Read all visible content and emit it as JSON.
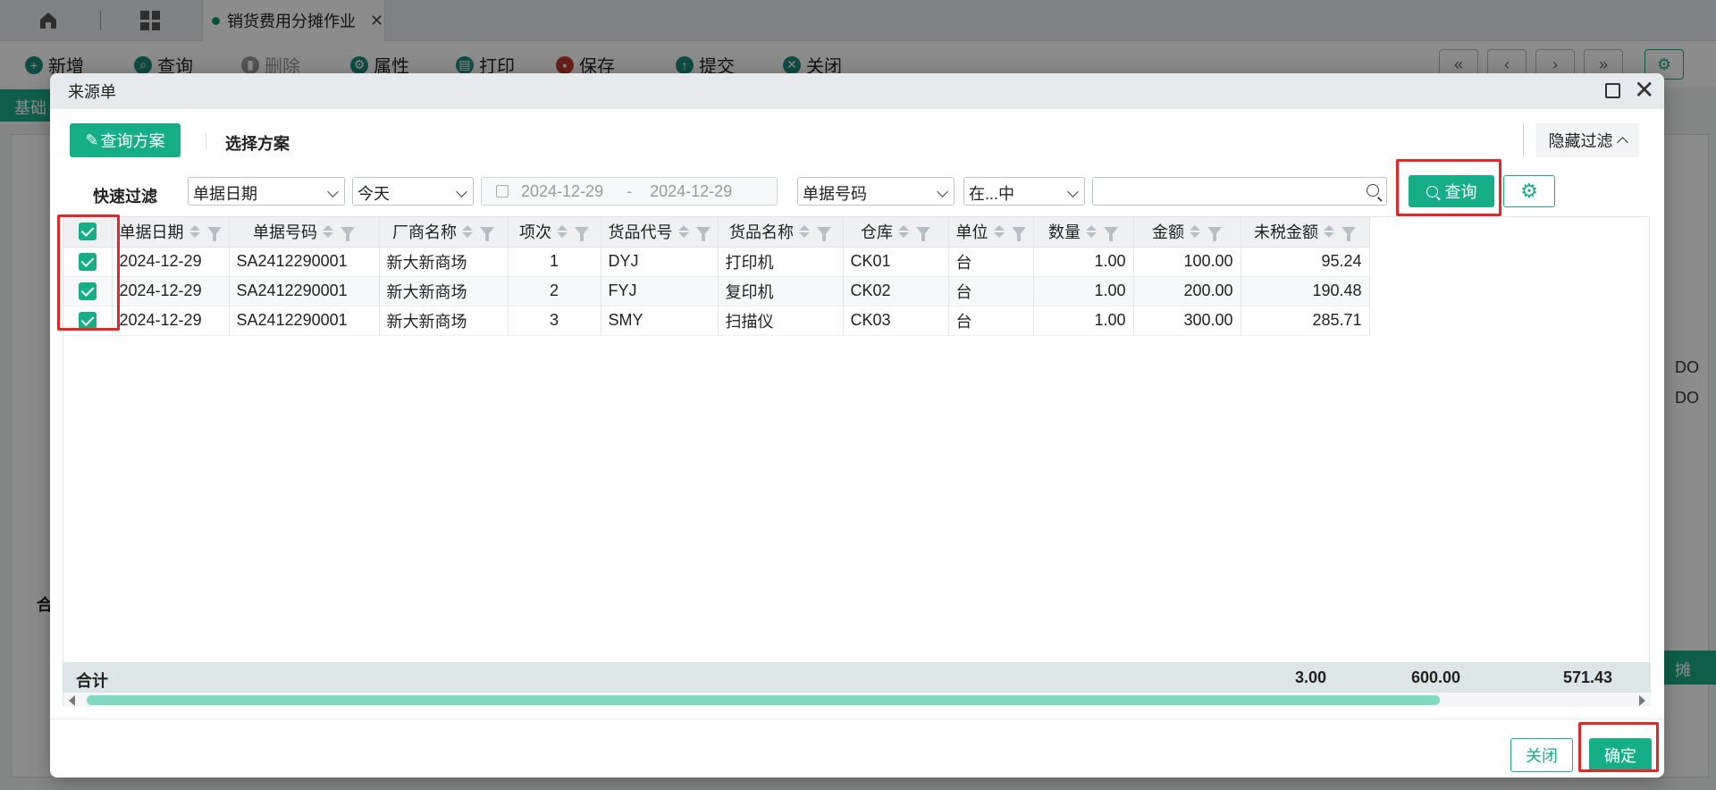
{
  "app": {
    "tab_title": "销货费用分摊作业",
    "toolbar": [
      "新增",
      "查询",
      "删除",
      "属性",
      "打印",
      "保存",
      "提交",
      "关闭"
    ],
    "side_tab": "基础",
    "sum_label": "合",
    "side_right_1": "DO",
    "side_right_2": "DO",
    "right_btn": "摊"
  },
  "modal": {
    "title": "来源单",
    "query_plan_btn": "查询方案",
    "select_plan_label": "选择方案",
    "hide_filter_btn": "隐藏过滤",
    "quick_filter_label": "快速过滤",
    "filter1_field": "单据日期",
    "filter1_op": "今天",
    "date_from": "2024-12-29",
    "date_sep": "-",
    "date_to": "2024-12-29",
    "filter2_field": "单据号码",
    "filter2_op": "在...中",
    "filter2_value": "",
    "query_btn": "查询",
    "close_btn": "关闭",
    "ok_btn": "确定"
  },
  "grid": {
    "columns": [
      "单据日期",
      "单据号码",
      "厂商名称",
      "项次",
      "货品代号",
      "货品名称",
      "仓库",
      "单位",
      "数量",
      "金额",
      "未税金额"
    ],
    "rows": [
      {
        "date": "2024-12-29",
        "no": "SA2412290001",
        "vendor": "新大新商场",
        "item": "1",
        "code": "DYJ",
        "name": "打印机",
        "wh": "CK01",
        "unit": "台",
        "qty": "1.00",
        "amt": "100.00",
        "net": "95.24"
      },
      {
        "date": "2024-12-29",
        "no": "SA2412290001",
        "vendor": "新大新商场",
        "item": "2",
        "code": "FYJ",
        "name": "复印机",
        "wh": "CK02",
        "unit": "台",
        "qty": "1.00",
        "amt": "200.00",
        "net": "190.48"
      },
      {
        "date": "2024-12-29",
        "no": "SA2412290001",
        "vendor": "新大新商场",
        "item": "3",
        "code": "SMY",
        "name": "扫描仪",
        "wh": "CK03",
        "unit": "台",
        "qty": "1.00",
        "amt": "300.00",
        "net": "285.71"
      }
    ],
    "sum_label": "合计",
    "sum_qty": "3.00",
    "sum_amt": "600.00",
    "sum_net": "571.43"
  },
  "colors": {
    "accent": "#16ae86",
    "highlight": "#e82424"
  }
}
